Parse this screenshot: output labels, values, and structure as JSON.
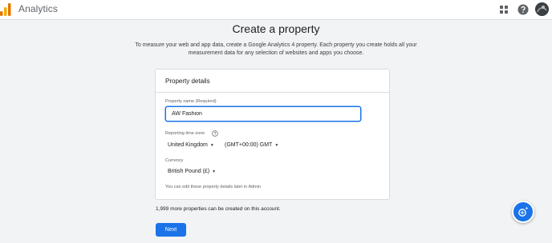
{
  "app": {
    "title": "Analytics",
    "logo_icon": "analytics-logo-icon",
    "colors": {
      "accent": "#1a73e8",
      "logo_orange": "#f9ab00",
      "logo_dark_orange": "#e37400"
    }
  },
  "header_icons": [
    "apps-grid-icon",
    "help-icon",
    "account-avatar"
  ],
  "page": {
    "title": "Create a property",
    "intro": "To measure your web and app data, create a Google Analytics 4 property. Each property you create holds all your measurement data for any selection of websites and apps you choose."
  },
  "card": {
    "title": "Property details",
    "property_name": {
      "label": "Property name (Required)",
      "value": "AW Fashion"
    },
    "time_zone": {
      "label": "Reporting time zone",
      "country": "United Kingdom",
      "offset": "(GMT+00:00) GMT"
    },
    "currency": {
      "label": "Currency",
      "value": "British Pound (£)"
    },
    "note": "You can edit these property details later in Admin"
  },
  "quota_text": "1,999 more properties can be created on this account.",
  "buttons": {
    "next": "Next"
  },
  "fab_icon": "assistant-sparkle-icon"
}
